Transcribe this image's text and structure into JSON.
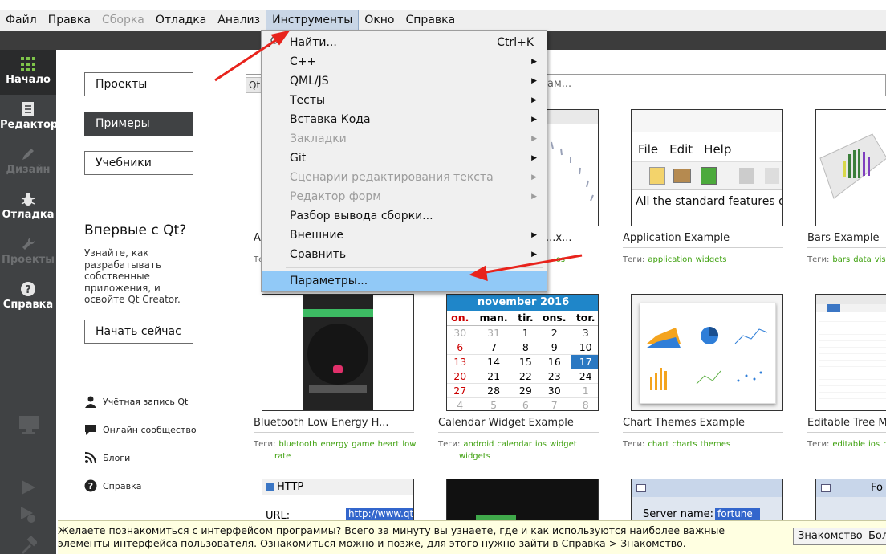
{
  "menubar": {
    "items": [
      {
        "label": "Файл",
        "state": "normal"
      },
      {
        "label": "Правка",
        "state": "normal"
      },
      {
        "label": "Сборка",
        "state": "disabled"
      },
      {
        "label": "Отладка",
        "state": "normal"
      },
      {
        "label": "Анализ",
        "state": "normal"
      },
      {
        "label": "Инструменты",
        "state": "active"
      },
      {
        "label": "Окно",
        "state": "normal"
      },
      {
        "label": "Справка",
        "state": "normal"
      }
    ]
  },
  "modes": [
    {
      "label": "Начало",
      "icon": "grid-icon",
      "state": "active"
    },
    {
      "label": "Редактор",
      "icon": "document-icon",
      "state": "normal"
    },
    {
      "label": "Дизайн",
      "icon": "pen-icon",
      "state": "disabled"
    },
    {
      "label": "Отладка",
      "icon": "bug-icon",
      "state": "normal"
    },
    {
      "label": "Проекты",
      "icon": "wrench-icon",
      "state": "disabled"
    },
    {
      "label": "Справка",
      "icon": "help-icon",
      "state": "normal"
    }
  ],
  "mode_bottom_icons": [
    "monitor-icon",
    "run-icon",
    "debug-run-icon",
    "build-hammer-icon"
  ],
  "welcome": {
    "projects_button": "Проекты",
    "examples_button": "Примеры",
    "tutorials_button": "Учебники",
    "first_title": "Впервые с Qt?",
    "first_desc": "Узнайте, как разрабатывать собственные приложения, и освойте Qt Creator.",
    "start_button": "Начать сейчас",
    "links": [
      {
        "label": "Учётная запись Qt",
        "icon": "user-icon"
      },
      {
        "label": "Онлайн сообщество",
        "icon": "chat-icon"
      },
      {
        "label": "Блоги",
        "icon": "rss-icon"
      },
      {
        "label": "Справка",
        "icon": "help-circle-icon"
      }
    ]
  },
  "search": {
    "qt_badge": "Qt",
    "tail_text": "ам..."
  },
  "examples": {
    "tags_label": "Теги:",
    "row1": [
      {
        "title": "A...",
        "tags": []
      },
      {
        "title": "...x...",
        "tags": [
          "ios"
        ]
      },
      {
        "title": "Application Example",
        "tags": [
          "application",
          "widgets"
        ]
      },
      {
        "title": "Bars Example",
        "tags": [
          "bars",
          "data",
          "visua"
        ]
      }
    ],
    "row2": [
      {
        "title": "Bluetooth Low Energy H...",
        "tags": [
          "bluetooth",
          "energy",
          "game",
          "heart",
          "low",
          "rate"
        ]
      },
      {
        "title": "Calendar Widget Example",
        "tags": [
          "android",
          "calendar",
          "ios",
          "widget",
          "widgets"
        ]
      },
      {
        "title": "Chart Themes Example",
        "tags": [
          "chart",
          "charts",
          "themes"
        ]
      },
      {
        "title": "Editable Tree Mo",
        "tags": [
          "editable",
          "ios",
          "m"
        ]
      }
    ],
    "app_thumb": {
      "menu": [
        "File",
        "Edit",
        "Help"
      ],
      "text": "All the standard features of"
    },
    "calendar_thumb": {
      "header": "november  2016",
      "weekdays": [
        "on.",
        "man.",
        "tir.",
        "ons.",
        "tor."
      ],
      "rows": [
        [
          "30",
          "31",
          "1",
          "2",
          "3"
        ],
        [
          "6",
          "7",
          "8",
          "9",
          "10"
        ],
        [
          "13",
          "14",
          "15",
          "16",
          "17"
        ],
        [
          "20",
          "21",
          "22",
          "23",
          "24"
        ],
        [
          "27",
          "28",
          "29",
          "30",
          "1"
        ],
        [
          "4",
          "5",
          "6",
          "7",
          "8"
        ]
      ]
    },
    "http_thumb": {
      "title": "HTTP",
      "url_label": "URL:",
      "url_value": "http://www.qt.io"
    },
    "server_thumb": {
      "label": "Server name:",
      "value": "fortune"
    },
    "fo_thumb": {
      "label": "Fo"
    }
  },
  "dropdown": {
    "items": [
      {
        "label": "Найти...",
        "shortcut": "Ctrl+K",
        "submenu": false,
        "state": "normal",
        "icon": "search-icon"
      },
      {
        "label": "C++",
        "shortcut": "",
        "submenu": true,
        "state": "normal"
      },
      {
        "label": "QML/JS",
        "shortcut": "",
        "submenu": true,
        "state": "normal"
      },
      {
        "label": "Тесты",
        "shortcut": "",
        "submenu": true,
        "state": "normal"
      },
      {
        "label": "Вставка Кода",
        "shortcut": "",
        "submenu": true,
        "state": "normal"
      },
      {
        "label": "Закладки",
        "shortcut": "",
        "submenu": true,
        "state": "disabled"
      },
      {
        "label": "Git",
        "shortcut": "",
        "submenu": true,
        "state": "normal"
      },
      {
        "label": "Сценарии редактирования текста",
        "shortcut": "",
        "submenu": true,
        "state": "disabled"
      },
      {
        "label": "Редактор форм",
        "shortcut": "",
        "submenu": true,
        "state": "disabled"
      },
      {
        "label": "Разбор вывода сборки...",
        "shortcut": "",
        "submenu": false,
        "state": "normal"
      },
      {
        "label": "Внешние",
        "shortcut": "",
        "submenu": true,
        "state": "normal"
      },
      {
        "label": "Сравнить",
        "shortcut": "",
        "submenu": true,
        "state": "normal"
      },
      {
        "label": "Параметры...",
        "shortcut": "",
        "submenu": false,
        "state": "highlighted"
      }
    ]
  },
  "infobar": {
    "text": "Желаете познакомиться с интерфейсом программы? Всего за минуту вы узнаете, где и как используются наиболее важные элементы интерфейса пользователя. Ознакомиться можно и позже, для этого нужно зайти в Справка > Знакомство.",
    "tour_button": "Знакомство",
    "more_button": "Бол"
  },
  "colors": {
    "accent_green": "#3fa10f",
    "highlight": "#91c9f7",
    "arrow_red": "#e8231c",
    "calendar_blue": "#1f86c9"
  }
}
